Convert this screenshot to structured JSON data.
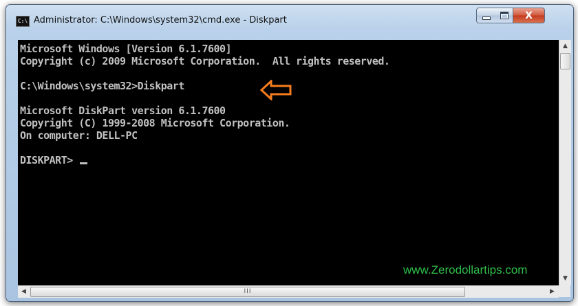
{
  "window": {
    "title": "Administrator: C:\\Windows\\system32\\cmd.exe - Diskpart",
    "app_icon_text": "C:\\",
    "close_label": "X"
  },
  "console": {
    "lines": [
      "Microsoft Windows [Version 6.1.7600]",
      "Copyright (c) 2009 Microsoft Corporation.  All rights reserved.",
      "",
      "C:\\Windows\\system32>Diskpart",
      "",
      "Microsoft DiskPart version 6.1.7600",
      "Copyright (C) 1999-2008 Microsoft Corporation.",
      "On computer: DELL-PC",
      "",
      "DISKPART> "
    ],
    "text_color": "#c0c0c0",
    "background": "#000000"
  },
  "annotation": {
    "arrow_color": "#f57d1f",
    "watermark": "www.Zerodollartips.com",
    "watermark_color": "#2fbf4b"
  },
  "scrollbars": {
    "up_icon": "▲",
    "down_icon": "▼",
    "left_icon": "◀",
    "right_icon": "▶",
    "thumb_grip": "III"
  }
}
